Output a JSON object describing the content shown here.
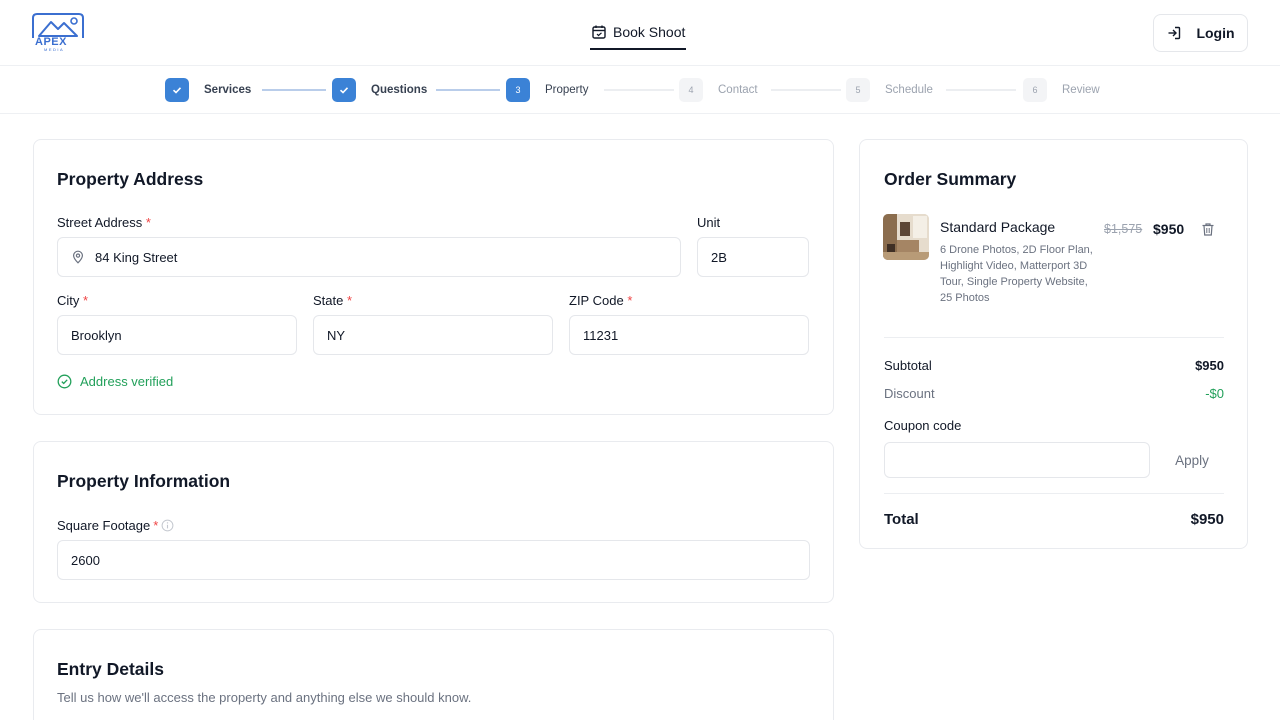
{
  "header": {
    "logo_text": "APEX",
    "logo_subtext": "MEDIA",
    "center_tab_label": "Book Shoot",
    "login_label": "Login"
  },
  "stepper": {
    "steps": [
      {
        "num": "1",
        "label": "Services",
        "state": "done"
      },
      {
        "num": "2",
        "label": "Questions",
        "state": "done"
      },
      {
        "num": "3",
        "label": "Property",
        "state": "active"
      },
      {
        "num": "4",
        "label": "Contact",
        "state": "todo"
      },
      {
        "num": "5",
        "label": "Schedule",
        "state": "todo"
      },
      {
        "num": "6",
        "label": "Review",
        "state": "todo"
      }
    ]
  },
  "address": {
    "title": "Property Address",
    "street_label": "Street Address",
    "street_value": "84 King Street",
    "unit_label": "Unit",
    "unit_value": "2B",
    "city_label": "City",
    "city_value": "Brooklyn",
    "state_label": "State",
    "state_value": "NY",
    "zip_label": "ZIP Code",
    "zip_value": "11231",
    "verified_text": "Address verified",
    "required_mark": "*"
  },
  "info": {
    "title": "Property Information",
    "sqft_label": "Square Footage",
    "sqft_value": "2600"
  },
  "entry": {
    "title": "Entry Details",
    "subtitle": "Tell us how we'll access the property and anything else we should know."
  },
  "summary": {
    "title": "Order Summary",
    "package_name": "Standard Package",
    "package_desc": "6 Drone Photos, 2D Floor Plan, Highlight Video, Matterport 3D Tour, Single Property Website, 25 Photos",
    "old_price": "$1,575",
    "price": "$950",
    "subtotal_label": "Subtotal",
    "subtotal_value": "$950",
    "discount_label": "Discount",
    "discount_value": "-$0",
    "coupon_label": "Coupon code",
    "coupon_placeholder": "",
    "apply_label": "Apply",
    "total_label": "Total",
    "total_value": "$950"
  },
  "colors": {
    "accent": "#3b82d6",
    "success": "#22a05a",
    "required": "#ef4444"
  },
  "icons": {
    "tab": "calendar-icon",
    "login": "login-arrow-icon",
    "street": "location-pin-icon",
    "verified": "check-circle-icon",
    "info": "info-icon",
    "delete": "trash-icon"
  }
}
